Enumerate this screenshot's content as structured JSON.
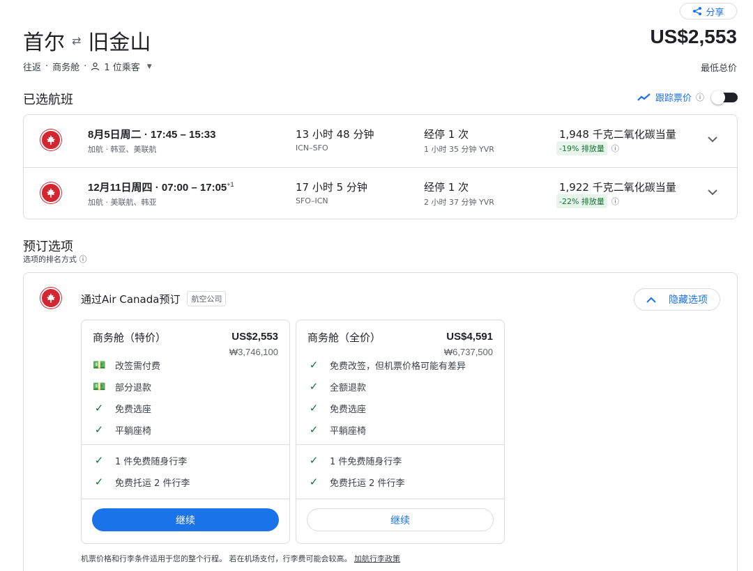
{
  "share_label": "分享",
  "route": {
    "from": "首尔",
    "to": "旧金山",
    "swap_glyph": "⇄"
  },
  "price_total": "US$2,553",
  "price_total_label": "最低总价",
  "trip_meta": {
    "type": "往返",
    "sep": "·",
    "cabin": "商务舱",
    "passengers": "1 位乘客"
  },
  "selected_title": "已选航班",
  "track_label": "跟踪票价",
  "flights": [
    {
      "datetime": "8月5日周二 · 17:45 – 15:33",
      "next_day": "",
      "airlines": "加航 · 韩亚、美联航",
      "duration": "13 小时 48 分钟",
      "route": "ICN–SFO",
      "stops": "经停 1 次",
      "layover": "1 小时 35 分钟 YVR",
      "emissions": "1,948 千克二氧化碳当量",
      "emissions_diff": "-19% 排放量"
    },
    {
      "datetime": "12月11日周四 · 07:00 – 17:05",
      "next_day": "+1",
      "airlines": "加航 · 美联航、韩亚",
      "duration": "17 小时 5 分钟",
      "route": "SFO–ICN",
      "stops": "经停 1 次",
      "layover": "2 小时 37 分钟 YVR",
      "emissions": "1,922 千克二氧化碳当量",
      "emissions_diff": "-22% 排放量"
    }
  ],
  "booking_title": "预订选项",
  "ranking_label": "选项的排名方式",
  "booking": {
    "via": "通过Air Canada预订",
    "tag": "航空公司",
    "hide_label": "隐藏选项",
    "note_text": "机票价格和行李条件适用于您的整个行程。 若在机场支付，行李费可能会较高。",
    "note_link": "加航行李政策"
  },
  "fares": [
    {
      "name": "商务舱（特价）",
      "price": "US$2,553",
      "krw": "₩3,746,100",
      "features": [
        {
          "icon": "fee-icon",
          "text": "改签需付费"
        },
        {
          "icon": "fee-icon",
          "text": "部分退款"
        },
        {
          "icon": "check-icon",
          "text": "免费选座"
        },
        {
          "icon": "check-icon",
          "text": "平躺座椅"
        }
      ],
      "bags": [
        "1 件免费随身行李",
        "免费托运 2 件行李"
      ],
      "cta": "继续"
    },
    {
      "name": "商务舱（全价）",
      "price": "US$4,591",
      "krw": "₩6,737,500",
      "features": [
        {
          "icon": "check-icon",
          "text": "免费改签，但机票价格可能有差异"
        },
        {
          "icon": "check-icon",
          "text": "全额退款"
        },
        {
          "icon": "check-icon",
          "text": "免费选座"
        },
        {
          "icon": "check-icon",
          "text": "平躺座椅"
        }
      ],
      "bags": [
        "1 件免费随身行李",
        "免费托运 2 件行李"
      ],
      "cta": "继续"
    }
  ],
  "colors": {
    "accent": "#1a73e8",
    "brand_red": "#d22630",
    "green": "#137333"
  }
}
